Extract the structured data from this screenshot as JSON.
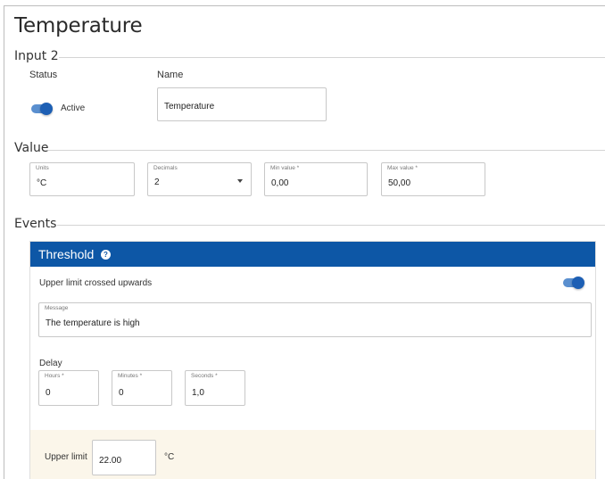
{
  "page": {
    "title": "Temperature"
  },
  "input_section": {
    "heading": "Input 2",
    "status_label": "Status",
    "status_value": "Active",
    "status_on": true,
    "name_label": "Name",
    "name_value": "Temperature"
  },
  "value_section": {
    "heading": "Value",
    "units": {
      "label": "Units",
      "value": "°C"
    },
    "decimals": {
      "label": "Decimals",
      "value": "2"
    },
    "min_value": {
      "label": "Min value *",
      "value": "0,00"
    },
    "max_value": {
      "label": "Max value *",
      "value": "50,00"
    }
  },
  "events_section": {
    "heading": "Events",
    "threshold": {
      "title": "Threshold",
      "help_glyph": "?",
      "condition_label": "Upper limit crossed upwards",
      "condition_on": true,
      "message": {
        "label": "Message",
        "value": "The temperature is high"
      },
      "delay": {
        "label": "Delay",
        "hours": {
          "label": "Hours *",
          "value": "0"
        },
        "minutes": {
          "label": "Minutes *",
          "value": "0"
        },
        "seconds": {
          "label": "Seconds *",
          "value": "1,0"
        }
      },
      "upper_limit": {
        "label": "Upper limit",
        "value": "22.00",
        "unit": "°C"
      }
    }
  },
  "colors": {
    "accent": "#0d57a6",
    "toggle_track": "#5a8fcf",
    "toggle_knob": "#1d5fb4",
    "limit_band": "#fbf6ea"
  },
  "icons": [
    "help-icon",
    "chevron-down-icon"
  ]
}
